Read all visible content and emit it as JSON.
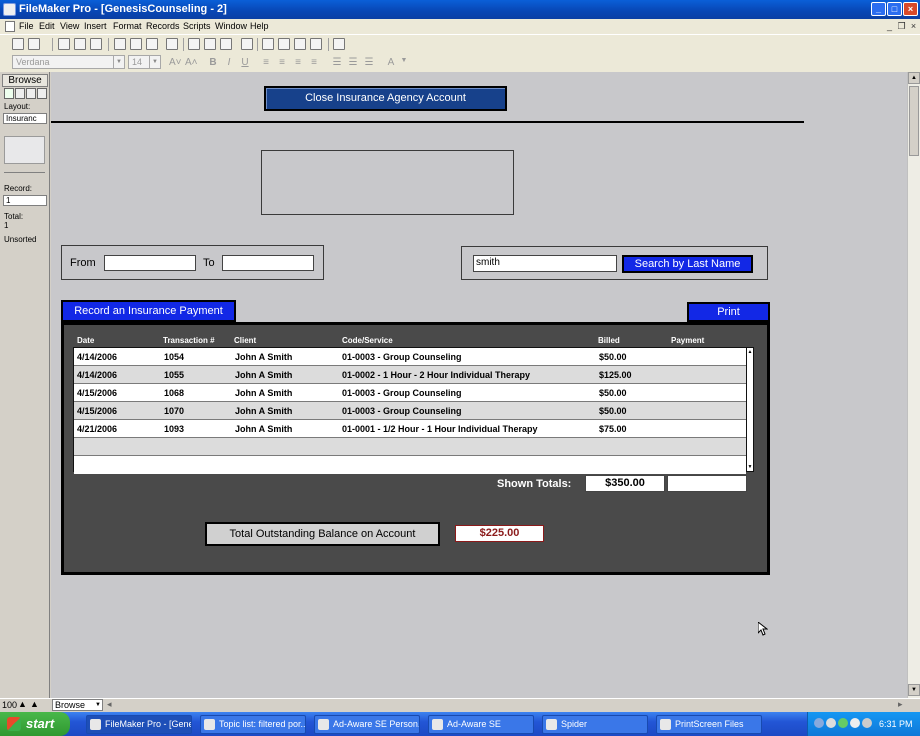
{
  "window": {
    "title": "FileMaker Pro - [GenesisCounseling - 2]",
    "min": "_",
    "max": "□",
    "close": "×"
  },
  "menu": [
    "File",
    "Edit",
    "View",
    "Insert",
    "Format",
    "Records",
    "Scripts",
    "Window",
    "Help"
  ],
  "format_bar": {
    "font": "Verdana",
    "size": "14"
  },
  "status_area": {
    "mode": "Browse",
    "layout_label": "Layout:",
    "layout_value": "Insuranc",
    "record_label": "Record:",
    "record_value": "1",
    "total_label": "Total:",
    "total_value": "1",
    "sort_status": "Unsorted"
  },
  "layout": {
    "close_button": "Close Insurance Agency Account",
    "from_label": "From",
    "from_value": "",
    "to_label": "To",
    "to_value": "",
    "search_value": "smith",
    "search_button": "Search by Last Name",
    "record_payment_button": "Record an Insurance Payment",
    "print_button": "Print"
  },
  "table": {
    "columns": [
      "Date",
      "Transaction #",
      "Client",
      "Code/Service",
      "Billed",
      "Payment"
    ],
    "rows": [
      {
        "date": "4/14/2006",
        "txn": "1054",
        "client": "John A Smith",
        "service": "01-0003 - Group Counseling",
        "billed": "$50.00",
        "payment": ""
      },
      {
        "date": "4/14/2006",
        "txn": "1055",
        "client": "John A Smith",
        "service": "01-0002 - 1 Hour - 2 Hour Individual Therapy",
        "billed": "$125.00",
        "payment": ""
      },
      {
        "date": "4/15/2006",
        "txn": "1068",
        "client": "John A Smith",
        "service": "01-0003 - Group Counseling",
        "billed": "$50.00",
        "payment": ""
      },
      {
        "date": "4/15/2006",
        "txn": "1070",
        "client": "John A Smith",
        "service": "01-0003 - Group Counseling",
        "billed": "$50.00",
        "payment": ""
      },
      {
        "date": "4/21/2006",
        "txn": "1093",
        "client": "John A Smith",
        "service": "01-0001 - 1/2 Hour - 1 Hour Individual Therapy",
        "billed": "$75.00",
        "payment": ""
      }
    ]
  },
  "totals": {
    "shown_label": "Shown Totals:",
    "shown_billed": "$350.00",
    "shown_payment": "",
    "balance_label": "Total Outstanding Balance on Account",
    "balance_value": "$225.00"
  },
  "bottom_bar": {
    "zoom": "100",
    "mode": "Browse"
  },
  "taskbar": {
    "start": "start",
    "items": [
      {
        "label": "FileMaker Pro - [Gene...",
        "active": true
      },
      {
        "label": "Topic list: filtered por...",
        "active": false
      },
      {
        "label": "Ad-Aware SE Person...",
        "active": false
      },
      {
        "label": "Ad-Aware SE",
        "active": false
      },
      {
        "label": "Spider",
        "active": false
      },
      {
        "label": "PrintScreen Files",
        "active": false
      }
    ],
    "clock": "6:31 PM"
  },
  "colors": {
    "panel": "#4a4a4a",
    "content_bg": "#c8c8cb",
    "button_navy": "#17418b",
    "button_blue": "#1228e6",
    "balance_text": "#8b1a1a"
  }
}
